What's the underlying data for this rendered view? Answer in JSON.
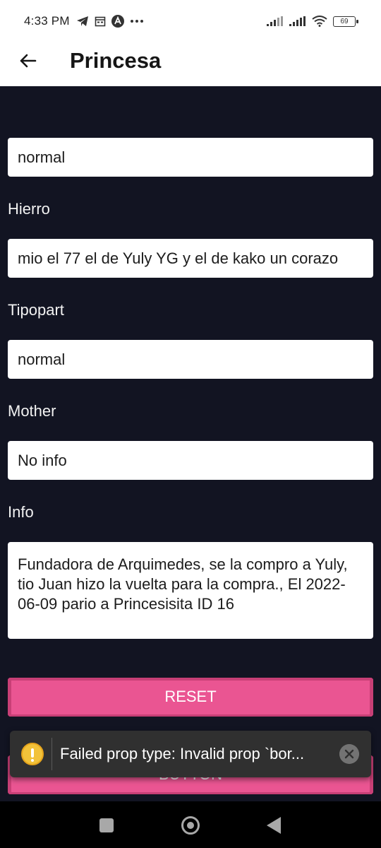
{
  "status_bar": {
    "time": "4:33 PM",
    "icons_left": [
      "telegram-icon",
      "calendar-icon",
      "app-icon",
      "more-dots-icon"
    ],
    "icons_right": [
      "signal-icon",
      "signal-icon",
      "wifi-icon",
      "battery-icon"
    ],
    "battery_level": "69"
  },
  "app_bar": {
    "title": "Princesa",
    "back_icon": "arrow-left-icon"
  },
  "form": {
    "field_top_value": "normal",
    "hierro_label": "Hierro",
    "hierro_value": "mio el 77 el de Yuly YG y el de kako un corazo",
    "tipopart_label": "Tipopart",
    "tipopart_value": "normal",
    "mother_label": "Mother",
    "mother_value": "No info",
    "info_label": "Info",
    "info_value": "Fundadora de Arquimedes,  se la compro a Yuly, tio Juan hizo la vuelta para la compra., El 2022-06-09 pario a Princesisita ID 16"
  },
  "buttons": {
    "reset_label": "RESET",
    "button_label": "BUTTON"
  },
  "toast": {
    "message": "Failed prop type: Invalid prop `bor...",
    "icon": "warning-icon",
    "close_icon": "close-icon"
  },
  "nav_bar": {
    "icons": [
      "recent-apps-icon",
      "home-icon",
      "back-icon"
    ]
  },
  "colors": {
    "background": "#121422",
    "button": "#ea5592",
    "toast": "#303030",
    "warning": "#f2c23a"
  }
}
